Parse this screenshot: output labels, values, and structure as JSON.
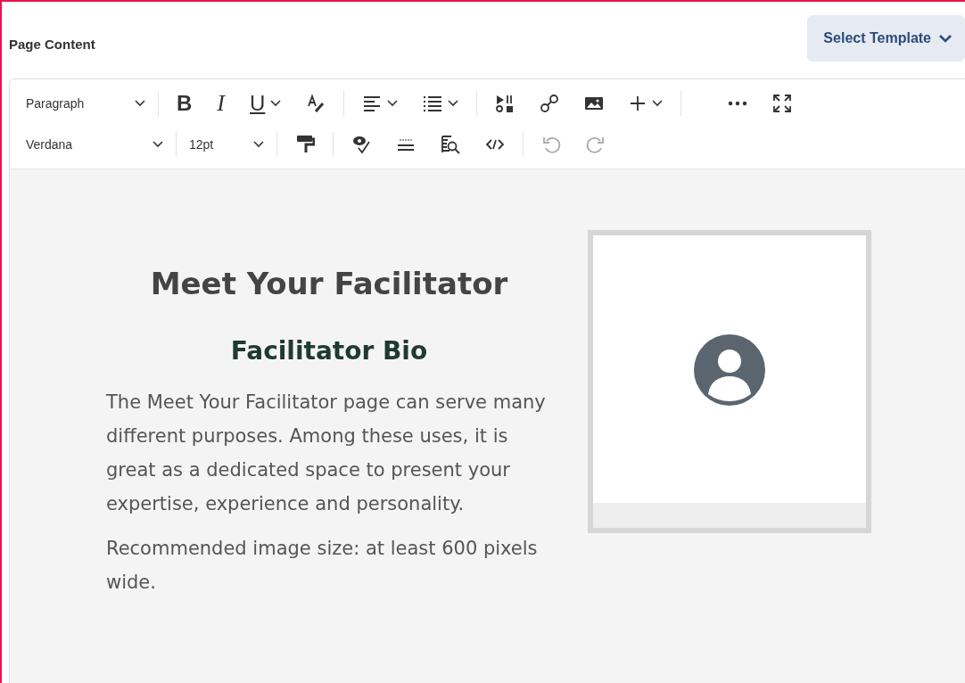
{
  "header": {
    "title": "Page Content",
    "template_button": {
      "label": "Select Template"
    }
  },
  "toolbar": {
    "rows": [
      [
        {
          "kind": "select",
          "value": "Paragraph"
        },
        {
          "kind": "sep"
        },
        {
          "kind": "tool",
          "label": "B"
        },
        {
          "kind": "tool",
          "label": "I"
        },
        {
          "kind": "tool",
          "label": "U",
          "menu": true
        },
        {
          "kind": "tool"
        },
        {
          "kind": "sep"
        },
        {
          "kind": "tool",
          "menu": true
        },
        {
          "kind": "tool",
          "menu": true
        },
        {
          "kind": "sep"
        },
        {
          "kind": "tool"
        },
        {
          "kind": "tool"
        },
        {
          "kind": "tool"
        },
        {
          "kind": "tool",
          "menu": true
        },
        {
          "kind": "sep"
        },
        {
          "kind": "spacer"
        },
        {
          "kind": "tool"
        },
        {
          "kind": "tool"
        }
      ],
      [
        {
          "kind": "select",
          "value": "Verdana"
        },
        {
          "kind": "sep"
        },
        {
          "kind": "select",
          "value": "12pt"
        },
        {
          "kind": "sep"
        },
        {
          "kind": "tool"
        },
        {
          "kind": "sep"
        },
        {
          "kind": "tool"
        },
        {
          "kind": "tool"
        },
        {
          "kind": "tool"
        },
        {
          "kind": "tool"
        },
        {
          "kind": "sep"
        },
        {
          "kind": "tool",
          "disabled": true
        },
        {
          "kind": "tool",
          "disabled": true
        }
      ]
    ]
  },
  "content": {
    "heading": "Meet Your Facilitator",
    "subheading": "Facilitator Bio",
    "paragraphs": [
      "The Meet Your Facilitator page can serve many different purposes. Among these uses, it is great as a dedicated space to present your expertise, experience and personality.",
      "Recommended image size: at least 600 pixels wide."
    ]
  }
}
